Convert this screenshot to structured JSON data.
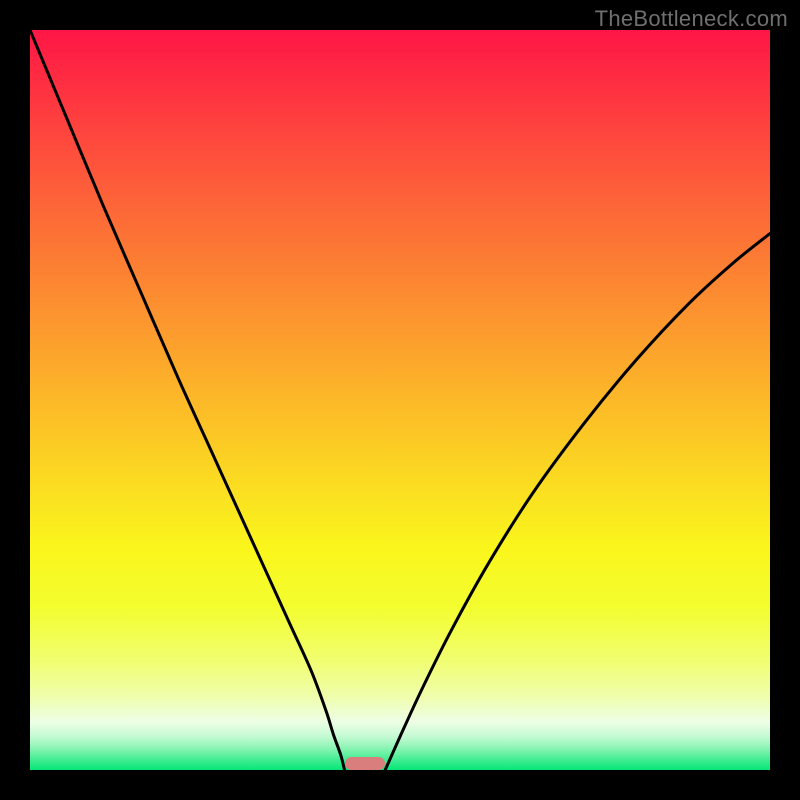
{
  "watermark": "TheBottleneck.com",
  "chart_data": {
    "type": "line",
    "title": "",
    "xlabel": "",
    "ylabel": "",
    "x_range": [
      0,
      100
    ],
    "y_range": [
      0,
      100
    ],
    "curves": [
      {
        "name": "left-branch",
        "x": [
          0,
          5,
          10,
          15,
          20,
          25,
          30,
          35,
          38,
          40,
          41,
          42,
          42.5
        ],
        "y": [
          100,
          88,
          76,
          64.5,
          53,
          42,
          31,
          20,
          13.4,
          8,
          4.8,
          2,
          0
        ]
      },
      {
        "name": "right-branch",
        "x": [
          48,
          50,
          53,
          57,
          62,
          68,
          75,
          82,
          89,
          95,
          100
        ],
        "y": [
          0,
          4.5,
          11,
          19,
          28,
          37.5,
          47,
          55.5,
          63,
          68.5,
          72.5
        ]
      }
    ],
    "marker": {
      "x_start": 42.5,
      "x_end": 48,
      "y": 0,
      "color": "#d97e7c"
    },
    "gradient_stops": [
      {
        "offset": 0.0,
        "color": "#fe1646"
      },
      {
        "offset": 0.1,
        "color": "#fe3840"
      },
      {
        "offset": 0.22,
        "color": "#fd6039"
      },
      {
        "offset": 0.35,
        "color": "#fc8931"
      },
      {
        "offset": 0.48,
        "color": "#fcb229"
      },
      {
        "offset": 0.6,
        "color": "#fbd822"
      },
      {
        "offset": 0.7,
        "color": "#faf61c"
      },
      {
        "offset": 0.78,
        "color": "#f3fd2f"
      },
      {
        "offset": 0.85,
        "color": "#f1fe6e"
      },
      {
        "offset": 0.9,
        "color": "#effeab"
      },
      {
        "offset": 0.935,
        "color": "#edfee6"
      },
      {
        "offset": 0.955,
        "color": "#c3fad2"
      },
      {
        "offset": 0.97,
        "color": "#8df4b5"
      },
      {
        "offset": 0.985,
        "color": "#46ed94"
      },
      {
        "offset": 1.0,
        "color": "#05e676"
      }
    ]
  },
  "colors": {
    "curve": "#000000",
    "background": "#000000",
    "watermark": "#6f6f6f"
  }
}
